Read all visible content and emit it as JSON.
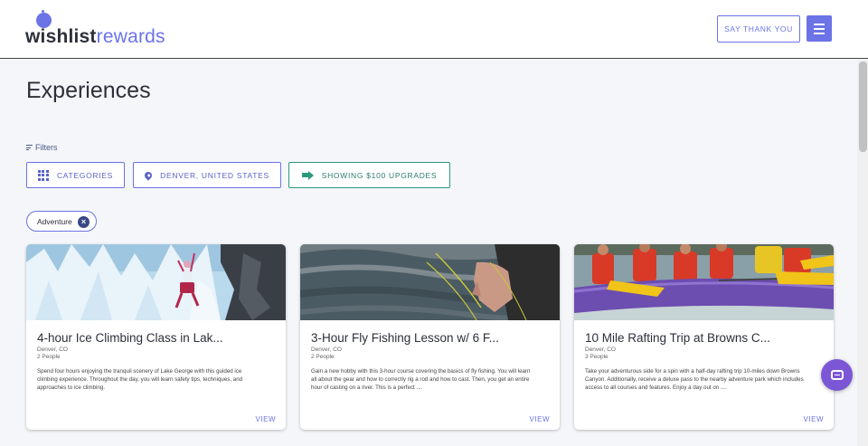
{
  "header": {
    "logo_wish": "wishlist",
    "logo_rewards": "rewards",
    "thank_label": "SAY THANK YOU"
  },
  "page": {
    "title": "Experiences",
    "filters_label": "Filters"
  },
  "filter_buttons": {
    "categories": "CATEGORIES",
    "location": "DENVER, UNITED STATES",
    "upgrades": "SHOWING $100 UPGRADES"
  },
  "chip": {
    "label": "Adventure"
  },
  "cards": [
    {
      "title": "4-hour Ice Climbing Class in Lak...",
      "location": "Denver, CO",
      "people": "2 People",
      "description": "Spend four hours enjoying the tranquil scenery of Lake George with this guided ice climbing experience. Throughout the day, you will learn safety tips, techniques, and approaches to ice climbing.",
      "view_label": "VIEW"
    },
    {
      "title": "3-Hour Fly Fishing Lesson w/ 6 F...",
      "location": "Denver, CO",
      "people": "2 People",
      "description": "Gain a new hobby with this 3-hour course covering the basics of fly fishing. You will learn all about the gear and how to correctly rig a rod and how to cast. Then, you get an entire hour of casting on a river. This is a perfect ....",
      "view_label": "VIEW"
    },
    {
      "title": "10 Mile Rafting Trip at Browns C...",
      "location": "Denver, CO",
      "people": "3 People",
      "description": "Take your adventurous side for a spin with a half-day rafting trip 10-miles down Browns Canyon. Additionally, receive a deluxe pass to the nearby adventure park which includes access to all courses and features. Enjoy a day out on ....",
      "view_label": "VIEW"
    }
  ],
  "colors": {
    "accent": "#6b73e6",
    "green": "#2a9a7e",
    "chat": "#7b57d6"
  }
}
